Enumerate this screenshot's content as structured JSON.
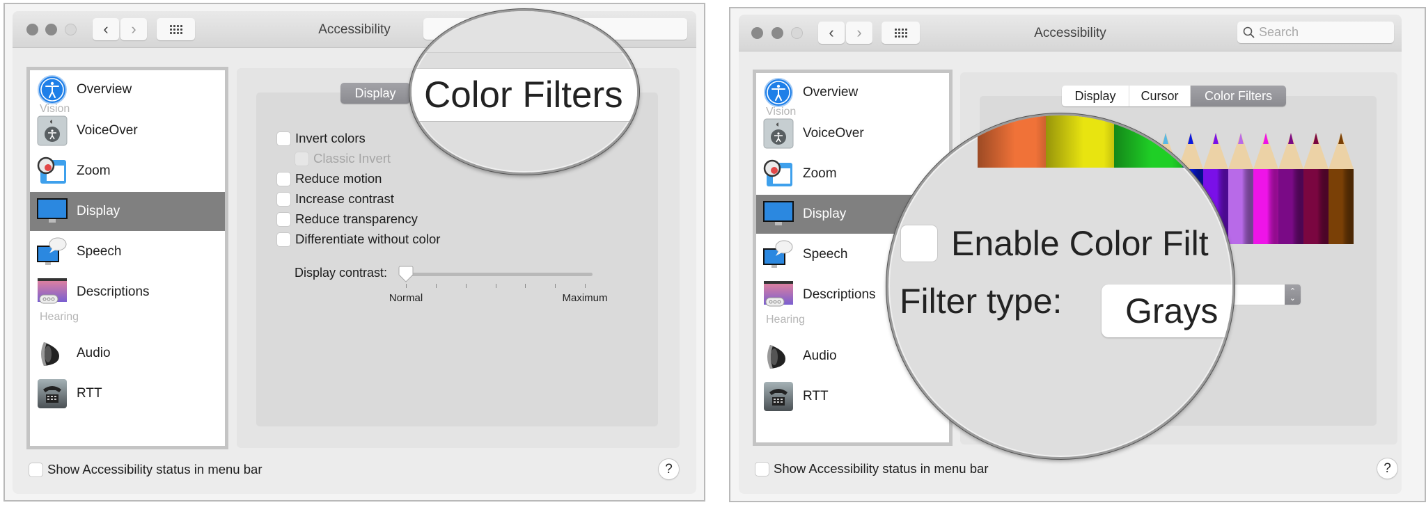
{
  "left_window": {
    "title": "Accessibility",
    "nav": {
      "back": "‹",
      "forward": "›"
    },
    "sidebar": {
      "items": [
        {
          "label": "Overview",
          "icon": "accessibility-icon"
        },
        {
          "header": "Vision"
        },
        {
          "label": "VoiceOver",
          "icon": "voiceover-icon"
        },
        {
          "label": "Zoom",
          "icon": "zoom-icon"
        },
        {
          "label": "Display",
          "icon": "display-icon",
          "selected": true
        },
        {
          "label": "Speech",
          "icon": "speech-icon"
        },
        {
          "label": "Descriptions",
          "icon": "descriptions-icon"
        },
        {
          "header": "Hearing"
        },
        {
          "label": "Audio",
          "icon": "speaker-icon"
        },
        {
          "label": "RTT",
          "icon": "telephone-icon"
        }
      ]
    },
    "tabs": [
      {
        "label": "Display",
        "active": true
      }
    ],
    "magnifier_text": "Color Filters",
    "checkboxes": [
      {
        "label": "Invert colors",
        "checked": false
      },
      {
        "label": "Classic Invert",
        "checked": false,
        "disabled": true
      },
      {
        "label": "Reduce motion",
        "checked": false
      },
      {
        "label": "Increase contrast",
        "checked": false
      },
      {
        "label": "Reduce transparency",
        "checked": false
      },
      {
        "label": "Differentiate without color",
        "checked": false
      }
    ],
    "slider": {
      "label": "Display contrast:",
      "min_label": "Normal",
      "max_label": "Maximum",
      "value": 0,
      "ticks": 7
    },
    "footer_checkbox": {
      "label": "Show Accessibility status in menu bar",
      "checked": false
    },
    "help_label": "?"
  },
  "right_window": {
    "title": "Accessibility",
    "search": {
      "placeholder": "Search"
    },
    "sidebar": {
      "items": [
        {
          "label": "Overview"
        },
        {
          "header": "Vision"
        },
        {
          "label": "VoiceOver"
        },
        {
          "label": "Zoom"
        },
        {
          "label": "Display",
          "selected": true
        },
        {
          "label": "Speech"
        },
        {
          "label": "Descriptions"
        },
        {
          "header": "Hearing"
        },
        {
          "label": "Audio"
        },
        {
          "label": "RTT"
        }
      ]
    },
    "tabs": [
      {
        "label": "Display",
        "active": false
      },
      {
        "label": "Cursor",
        "active": false
      },
      {
        "label": "Color Filters",
        "active": true
      }
    ],
    "enable_checkbox": {
      "label": "Enable Color Filters",
      "visible_label": "Enable Color Filt",
      "checked": false
    },
    "filter_type": {
      "label": "Filter type:",
      "value": "Grayscale",
      "visible_value": "Grays"
    },
    "pencil_colors": [
      "#e23a3a",
      "#f07238",
      "#e8e410",
      "#1fcf26",
      "#1a8fa0",
      "#58b8e6",
      "#0a1adf",
      "#7a10e8",
      "#b86ae8",
      "#ee14e8",
      "#7a0a86",
      "#7a0640",
      "#7a4006"
    ],
    "footer_checkbox": {
      "label": "Show Accessibility status in menu bar",
      "checked": false
    },
    "help_label": "?"
  }
}
